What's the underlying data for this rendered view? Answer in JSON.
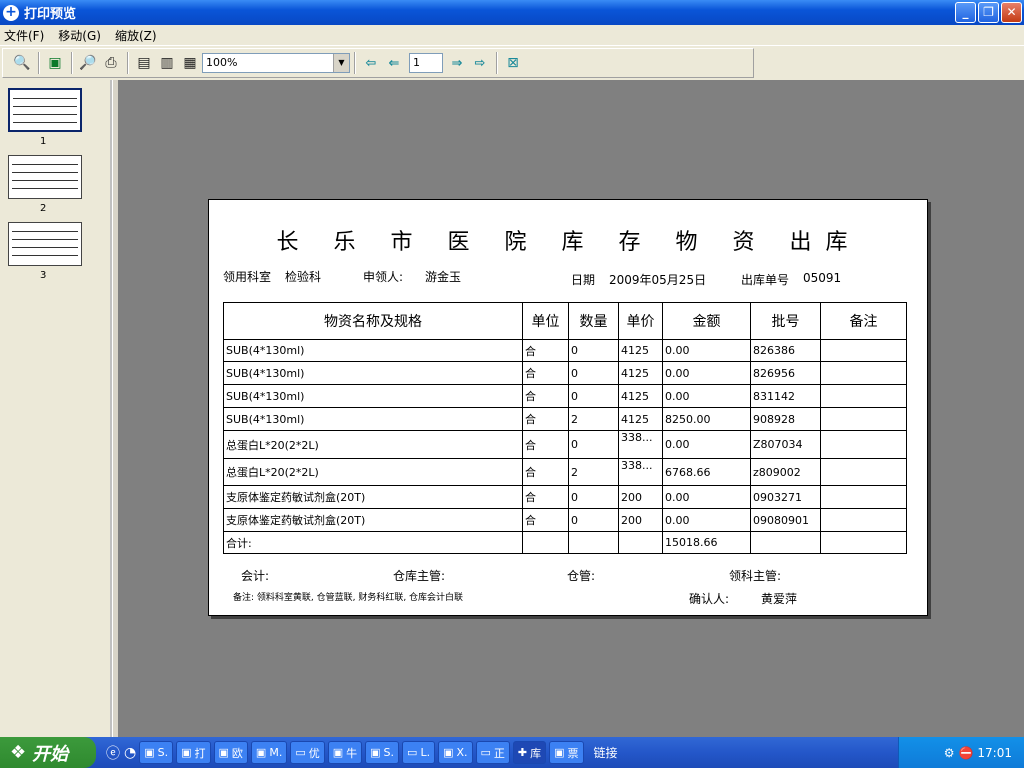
{
  "window": {
    "title": "打印预览",
    "buttons": [
      "_",
      "❐",
      "✕"
    ]
  },
  "menu": [
    "文件(F)",
    "移动(G)",
    "缩放(Z)"
  ],
  "toolbar": {
    "zoom": "100%",
    "page": "1"
  },
  "thumbs": [
    "1",
    "2",
    "3"
  ],
  "doc": {
    "title": "长 乐 市 医 院 库 存 物 资 出库",
    "dept_label": "领用科室",
    "dept": "检验科",
    "recipient_label": "申领人:",
    "recipient": "游金玉",
    "date_label": "日期",
    "date": "2009年05月25日",
    "no_label": "出库单号",
    "no": "05091",
    "headers": [
      "物资名称及规格",
      "单位",
      "数量",
      "单价",
      "金额",
      "批号",
      "备注"
    ],
    "rows": [
      [
        "SUB(4*130ml)",
        "合",
        "0",
        "4125",
        "0.00",
        "826386",
        ""
      ],
      [
        "SUB(4*130ml)",
        "合",
        "0",
        "4125",
        "0.00",
        "826956",
        ""
      ],
      [
        "SUB(4*130ml)",
        "合",
        "0",
        "4125",
        "0.00",
        "831142",
        ""
      ],
      [
        "SUB(4*130ml)",
        "合",
        "2",
        "4125",
        "8250.00",
        "908928",
        ""
      ],
      [
        "总蛋白L*20(2*2L)",
        "合",
        "0",
        "338...",
        "0.00",
        "Z807034",
        ""
      ],
      [
        "总蛋白L*20(2*2L)",
        "合",
        "2",
        "338...",
        "6768.66",
        "z809002",
        ""
      ],
      [
        "支原体鉴定药敏试剂盒(20T)",
        "合",
        "0",
        "200",
        "0.00",
        "0903271",
        ""
      ],
      [
        "支原体鉴定药敏试剂盒(20T)",
        "合",
        "0",
        "200",
        "0.00",
        "09080901",
        ""
      ]
    ],
    "total_label": "合计:",
    "total": "15018.66",
    "sig_accountant": "会计:",
    "sig_warehouse_mgr": "仓库主管:",
    "sig_keeper": "仓管:",
    "sig_dept_mgr": "领科主管:",
    "note": "备注: 领料科室黄联, 仓管蓝联, 财务科红联, 仓库会计白联",
    "confirm_label": "确认人:",
    "confirm": "黄爱萍"
  },
  "taskbar": {
    "start": "开始",
    "tasks": [
      "S.",
      "打",
      "欧",
      "M.",
      "优",
      "牛",
      "S.",
      "L.",
      "X.",
      "正",
      "库",
      "票"
    ],
    "links": "链接",
    "clock": "17:01"
  }
}
